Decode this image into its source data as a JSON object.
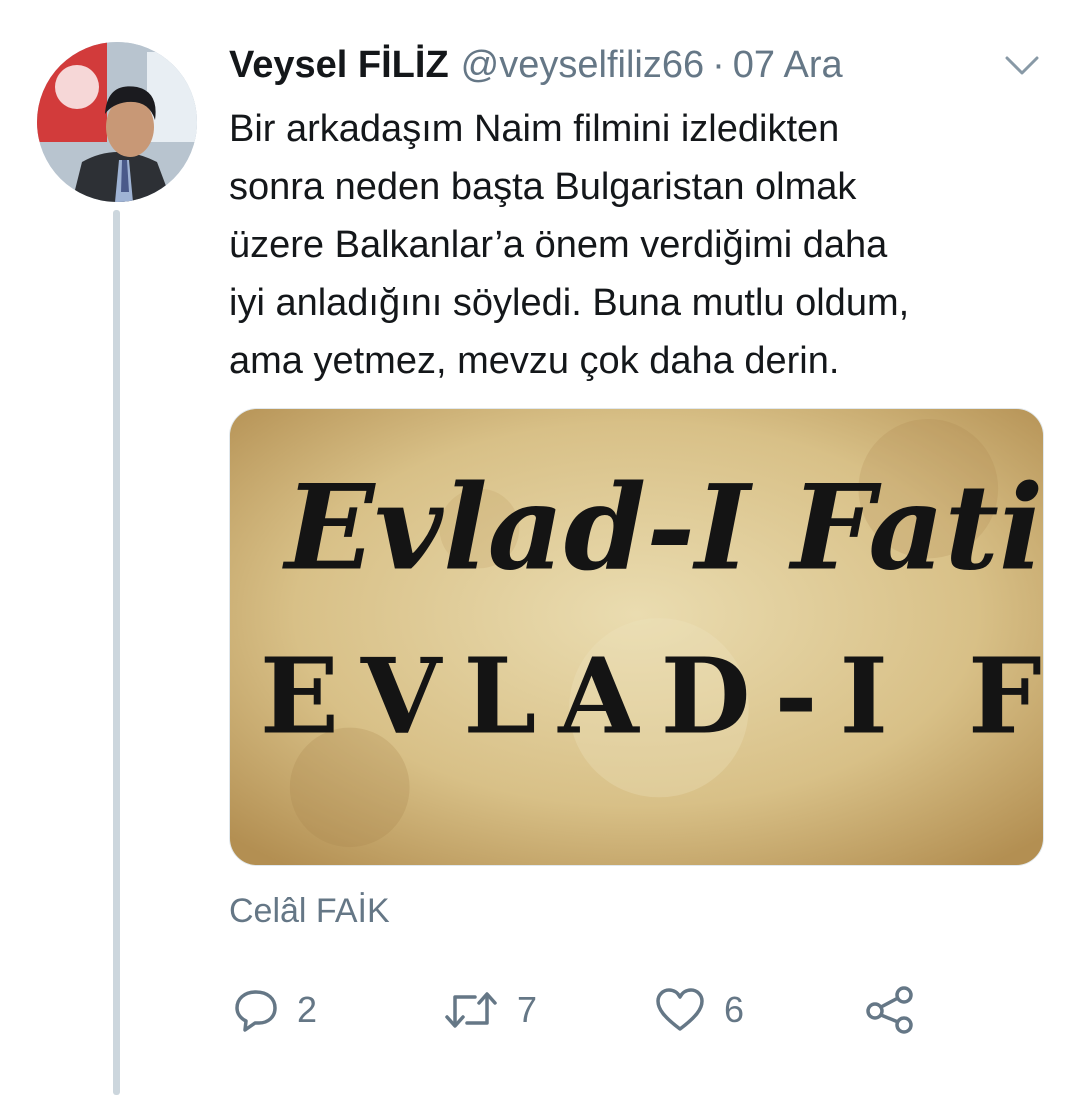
{
  "tweet": {
    "author": {
      "name": "Veysel FİLİZ",
      "handle": "@veyselfiliz66",
      "avatar_icon": "profile-photo"
    },
    "separator": "·",
    "date": "07 Ara",
    "text_lines": [
      "Bir arkadaşım Naim filmini izledikten",
      "sonra neden başta Bulgaristan olmak",
      "üzere Balkanlar’a önem verdiğimi daha",
      "iyi anladığını söyledi. Buna mutlu oldum,",
      "ama yetmez, mevzu çok daha derin."
    ],
    "media": {
      "line1": "Evlad-I Fatih",
      "line2": "EVLAD-I FATIH",
      "background": "#d9c28c"
    },
    "attribution": "Celâl FAİK",
    "actions": {
      "reply": {
        "icon": "reply-icon",
        "count": "2"
      },
      "retweet": {
        "icon": "retweet-icon",
        "count": "7"
      },
      "like": {
        "icon": "heart-icon",
        "count": "6"
      },
      "share": {
        "icon": "share-icon"
      }
    },
    "menu_icon": "chevron-down-icon"
  },
  "colors": {
    "text": "#14171a",
    "secondary": "#657786",
    "thread_line": "#ccd6dd"
  }
}
